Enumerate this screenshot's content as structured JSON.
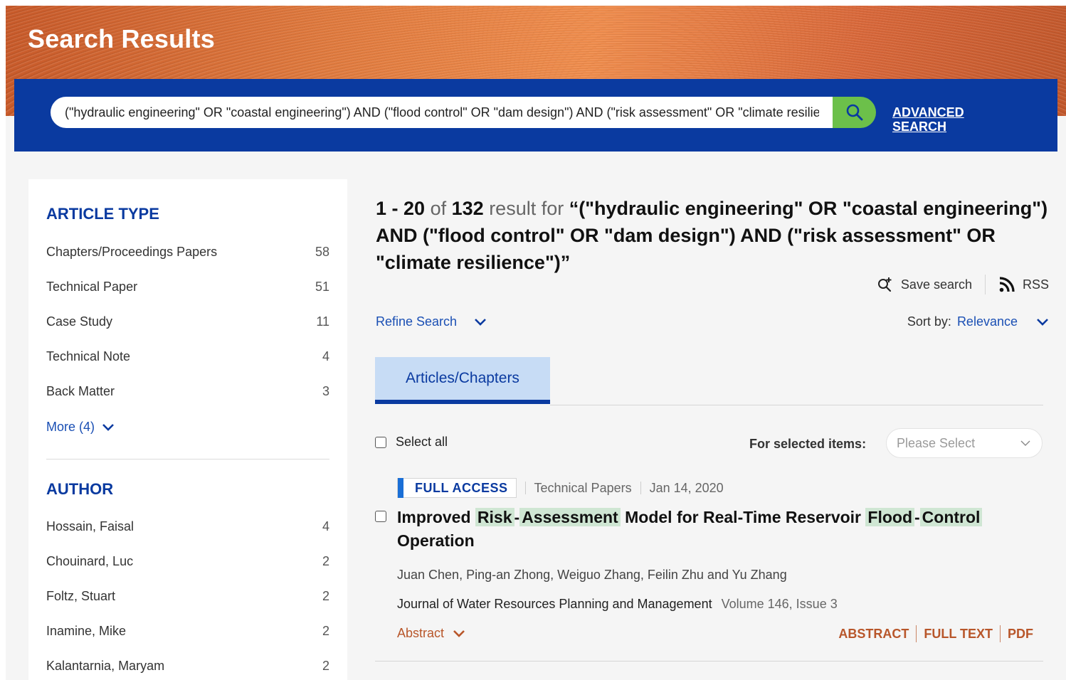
{
  "header": {
    "title": "Search Results",
    "search_value": "(\"hydraulic engineering\" OR \"coastal engineering\") AND (\"flood control\" OR \"dam design\") AND (\"risk assessment\" OR \"climate resilience\")",
    "search_icon": "search-icon",
    "advanced_line1": "ADVANCED",
    "advanced_line2": "SEARCH"
  },
  "sidebar": {
    "article_type_title": "ARTICLE TYPE",
    "article_types": [
      {
        "label": "Chapters/Proceedings Papers",
        "count": "58"
      },
      {
        "label": "Technical Paper",
        "count": "51"
      },
      {
        "label": "Case Study",
        "count": "11"
      },
      {
        "label": "Technical Note",
        "count": "4"
      },
      {
        "label": "Back Matter",
        "count": "3"
      }
    ],
    "more_label": "More (4)",
    "author_title": "AUTHOR",
    "authors": [
      {
        "label": "Hossain, Faisal",
        "count": "4"
      },
      {
        "label": "Chouinard, Luc",
        "count": "2"
      },
      {
        "label": "Foltz, Stuart",
        "count": "2"
      },
      {
        "label": "Inamine, Mike",
        "count": "2"
      },
      {
        "label": "Kalantarnia, Maryam",
        "count": "2"
      }
    ]
  },
  "results": {
    "range": "1 - 20",
    "of": "of",
    "total": "132",
    "result_for": "result for",
    "query_display": "“(\"hydraulic engineering\" OR \"coastal engineering\") AND (\"flood control\" OR \"dam design\") AND (\"risk assessment\" OR \"climate resilience\")”",
    "save_search": "Save search",
    "rss": "RSS",
    "refine_search": "Refine Search",
    "sort_label": "Sort by:",
    "sort_value": "Relevance",
    "tab_label": "Articles/Chapters",
    "select_all": "Select all",
    "for_selected": "For selected items:",
    "please_select": "Please Select"
  },
  "item": {
    "access": "FULL ACCESS",
    "type": "Technical Papers",
    "date": "Jan 14, 2020",
    "title_parts": {
      "improved": "Improved",
      "risk": "Risk",
      "dash": "-",
      "assessment": "Assessment",
      "middle": "Model for Real-Time Reservoir",
      "flood": "Flood",
      "control": "Control",
      "operation": "Operation"
    },
    "authors": "Juan Chen, Ping-an Zhong, Weiguo Zhang, Feilin Zhu and Yu Zhang",
    "journal": "Journal of Water Resources Planning and Management",
    "volume": "Volume 146, Issue 3",
    "abstract_toggle": "Abstract",
    "actions": {
      "abstract": "ABSTRACT",
      "full_text": "FULL TEXT",
      "pdf": "PDF"
    }
  },
  "colors": {
    "brand_blue": "#0a3aa0",
    "link_blue": "#1a4fb4",
    "search_green": "#6cc04a",
    "accent_orange": "#b8562a",
    "highlight_green": "#cfe6d3"
  }
}
